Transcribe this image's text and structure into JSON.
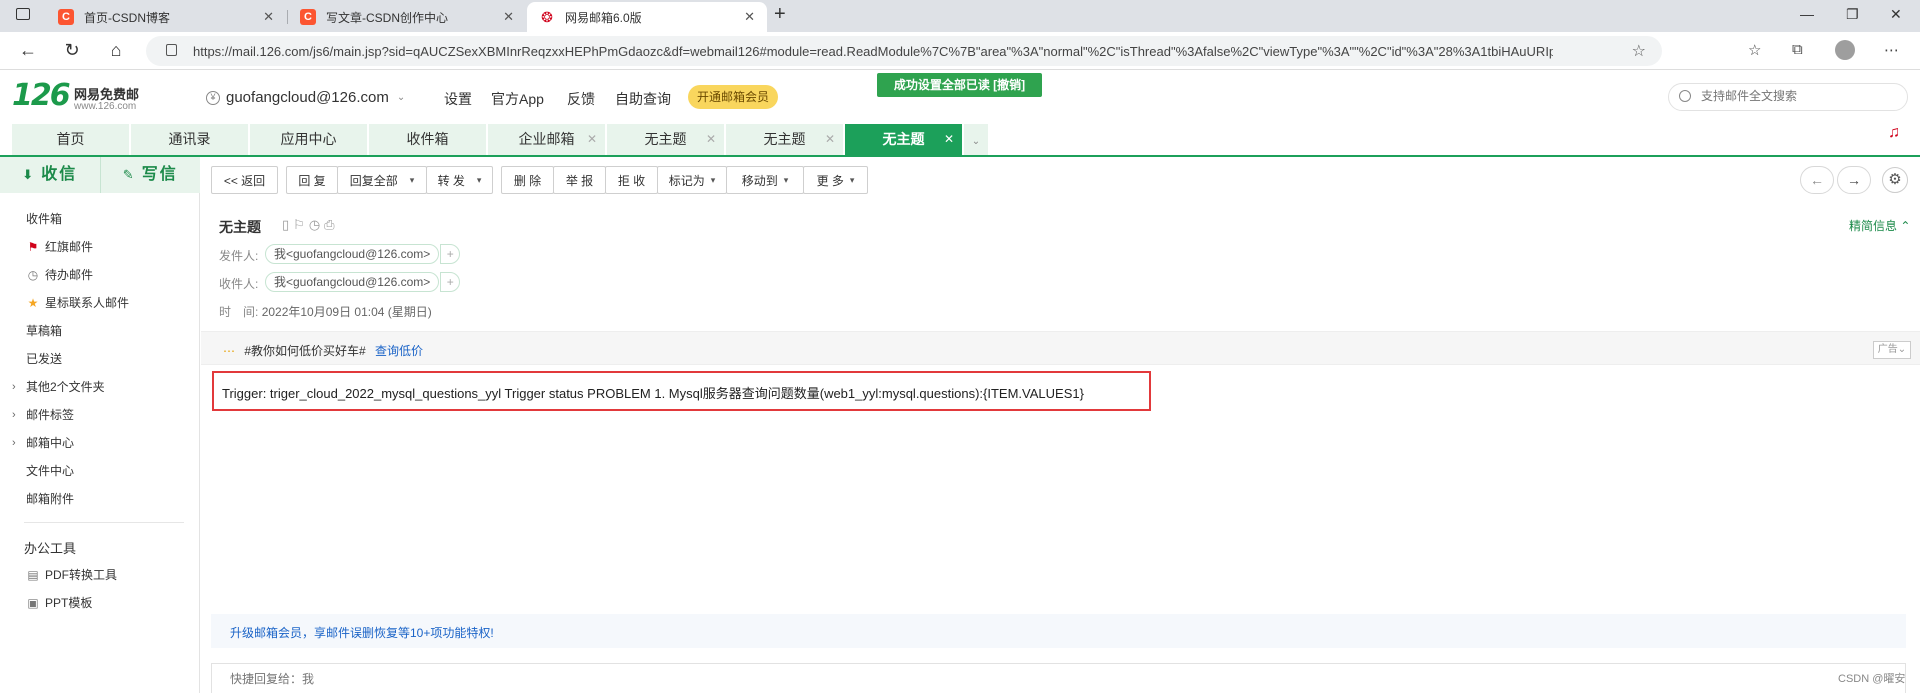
{
  "browser": {
    "tabs": [
      {
        "title": "首页-CSDN博客",
        "icon": "csdn-icon",
        "active": false
      },
      {
        "title": "写文章-CSDN创作中心",
        "icon": "csdn-icon",
        "active": false
      },
      {
        "title": "网易邮箱6.0版",
        "icon": "netease-icon",
        "active": true
      }
    ],
    "url": "https://mail.126.com/js6/main.jsp?sid=qAUCZSexXBMInrReqzxxHEPhPmGdaozc&df=webmail126#module=read.ReadModule%7C%7B\"area\"%3A\"normal\"%2C\"isThread\"%3Afalse%2C\"viewType\"%3A\"\"%2C\"id\"%3A\"28%3A1tbiHAuURIpEl...",
    "colors": {
      "csdn": "#fc5531",
      "netease": "#d0021b"
    }
  },
  "header": {
    "logo_number": "126",
    "logo_name": "网易免费邮",
    "logo_domain": "www.126.com",
    "account": "guofangcloud@126.com",
    "links": [
      "设置",
      "官方App",
      "反馈",
      "自助查询"
    ],
    "vip_button": "开通邮箱会员",
    "toast": "成功设置全部已读 [撤销]",
    "search_placeholder": "支持邮件全文搜索"
  },
  "module_tabs": [
    {
      "label": "首页",
      "closable": false,
      "active": false
    },
    {
      "label": "通讯录",
      "closable": false,
      "active": false
    },
    {
      "label": "应用中心",
      "closable": false,
      "active": false
    },
    {
      "label": "收件箱",
      "closable": false,
      "active": false
    },
    {
      "label": "企业邮箱",
      "closable": true,
      "active": false
    },
    {
      "label": "无主题",
      "closable": true,
      "active": false
    },
    {
      "label": "无主题",
      "closable": true,
      "active": false
    },
    {
      "label": "无主题",
      "closable": true,
      "active": true
    }
  ],
  "sidebar": {
    "receive": "收信",
    "compose": "写信",
    "folders": [
      {
        "label": "收件箱",
        "icon": ""
      },
      {
        "label": "红旗邮件",
        "icon": "red-flag-icon"
      },
      {
        "label": "待办邮件",
        "icon": "clock-icon"
      },
      {
        "label": "星标联系人邮件",
        "icon": "star-icon"
      },
      {
        "label": "草稿箱",
        "icon": ""
      },
      {
        "label": "已发送",
        "icon": ""
      },
      {
        "label": "其他2个文件夹",
        "icon": "caret"
      },
      {
        "label": "邮件标签",
        "icon": "caret"
      },
      {
        "label": "邮箱中心",
        "icon": "caret"
      },
      {
        "label": "文件中心",
        "icon": ""
      },
      {
        "label": "邮箱附件",
        "icon": ""
      }
    ],
    "tools_title": "办公工具",
    "tools": [
      {
        "label": "PDF转换工具",
        "icon": "pdf-icon"
      },
      {
        "label": "PPT模板",
        "icon": "ppt-icon"
      }
    ]
  },
  "toolbar": {
    "back": "<< 返回",
    "reply": "回 复",
    "reply_all": "回复全部",
    "forward": "转 发",
    "delete": "删 除",
    "report": "举 报",
    "reject": "拒 收",
    "mark_as": "标记为",
    "move_to": "移动到",
    "more": "更 多"
  },
  "mail": {
    "subject": "无主题",
    "brief_toggle": "精简信息",
    "from_label": "发件人:",
    "from": "我<guofangcloud@126.com>",
    "to_label": "收件人:",
    "to": "我<guofangcloud@126.com>",
    "time_label": "时　间:",
    "time": "2022年10月09日 01:04 (星期日)",
    "ad_text": "#教你如何低价买好车#",
    "ad_link": "查询低价",
    "ad_tag": "广告",
    "body": "Trigger: triger_cloud_2022_mysql_questions_yyl Trigger status PROBLEM 1. Mysql服务器查询问题数量(web1_yyl:mysql.questions):{ITEM.VALUES1}",
    "highlight_color": "#e2393b"
  },
  "footer": {
    "upgrade": "升级邮箱会员，享邮件误删恢复等10+项功能特权!",
    "reply_placeholder": "快捷回复给：我",
    "watermark": "CSDN @曜安"
  }
}
